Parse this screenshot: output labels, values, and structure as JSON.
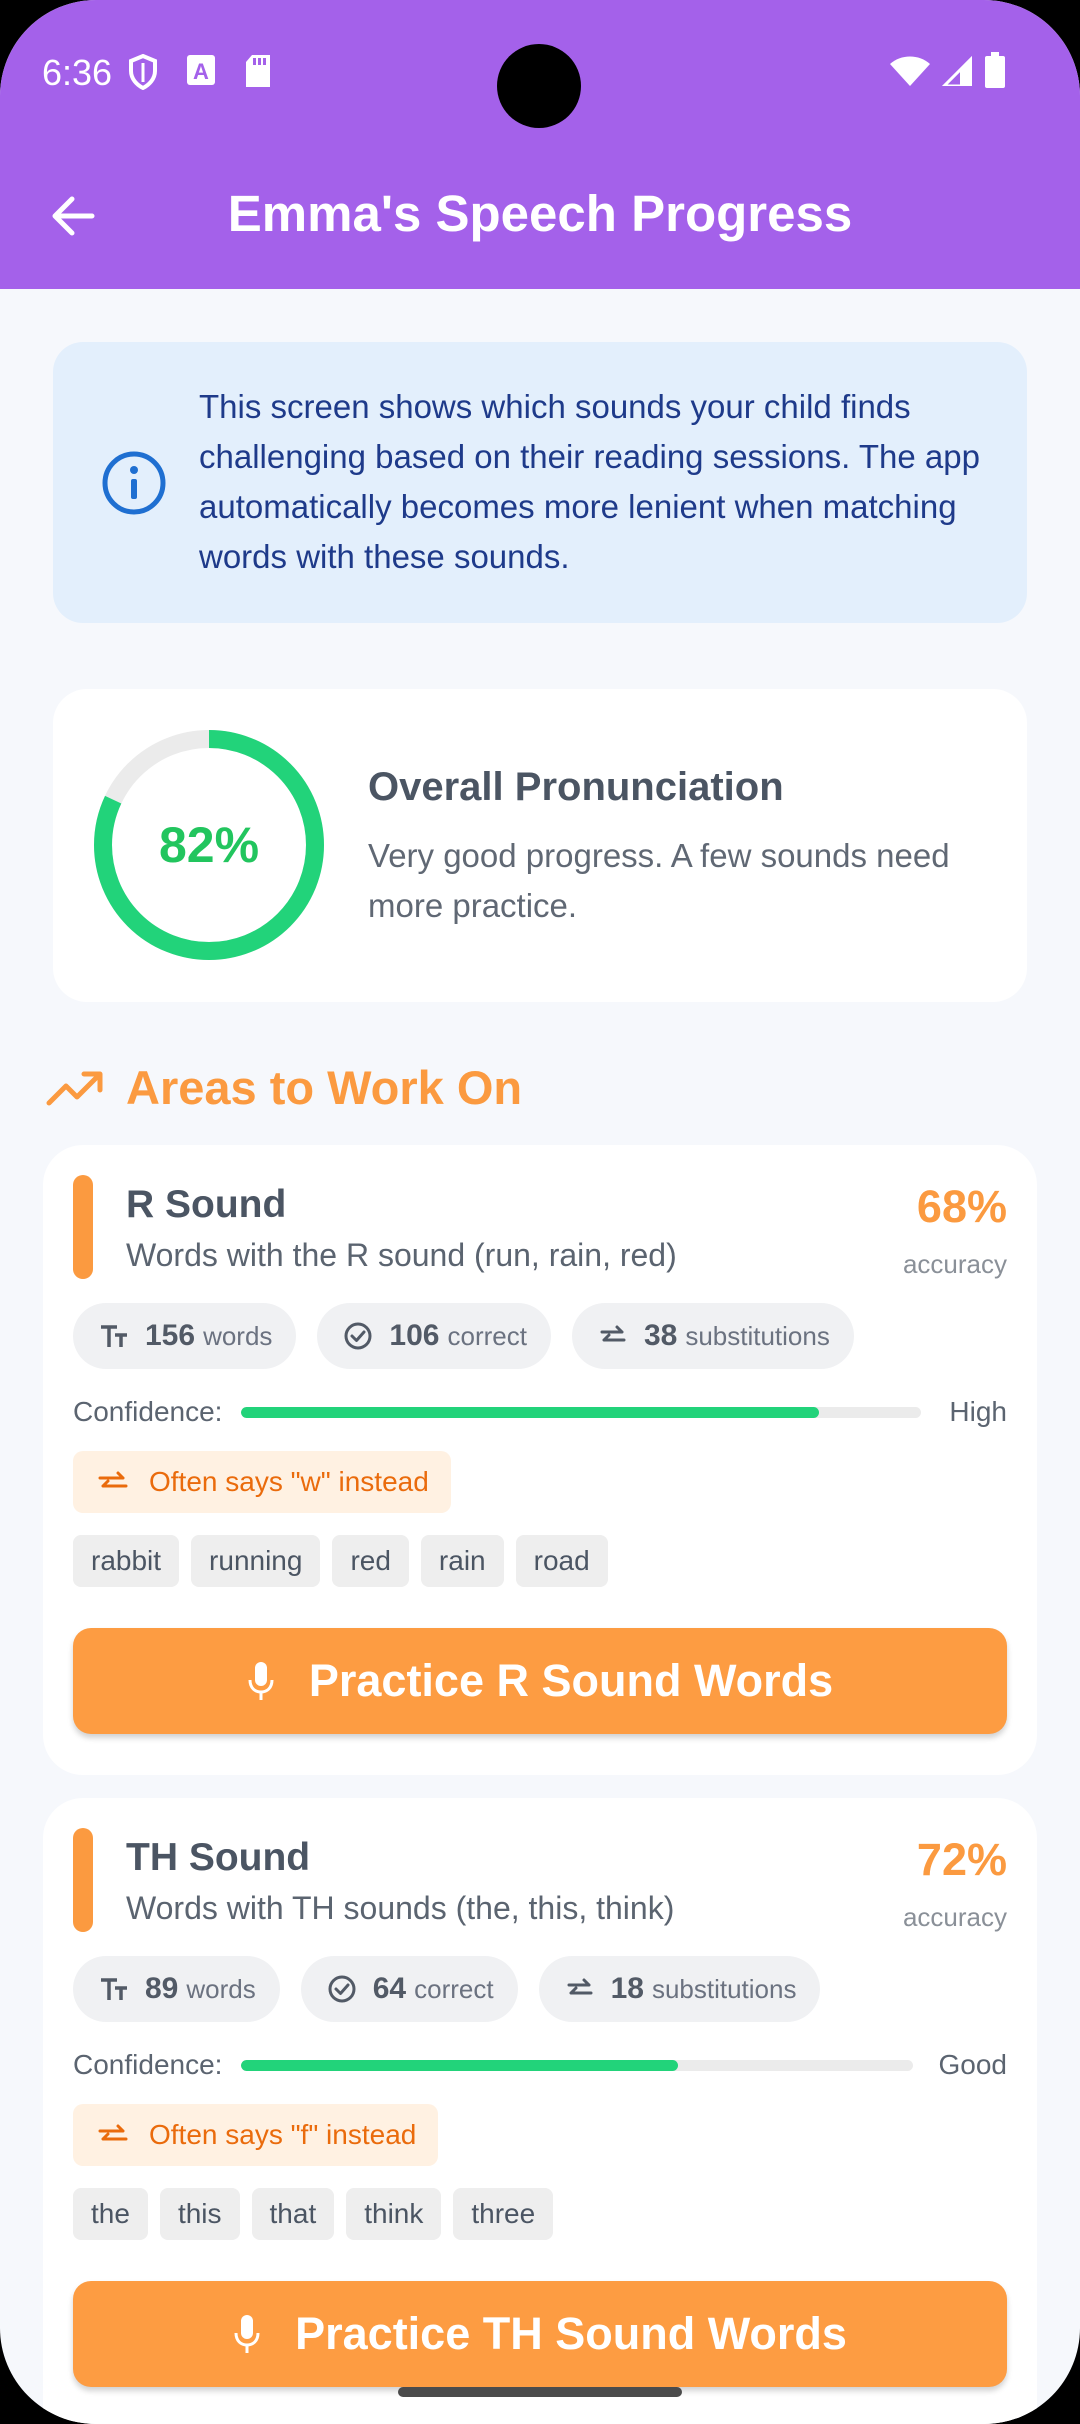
{
  "status_bar": {
    "time": "6:36"
  },
  "app_bar": {
    "title": "Emma's Speech Progress"
  },
  "info": {
    "text": "This screen shows which sounds your child finds challenging based on their reading sessions. The app automatically becomes more lenient when matching words with these sounds."
  },
  "overall": {
    "percent_label": "82%",
    "progress": 0.82,
    "title": "Overall Pronunciation",
    "subtitle": "Very good progress. A few sounds need more practice."
  },
  "section": {
    "title": "Areas to Work On"
  },
  "sounds": [
    {
      "title": "R Sound",
      "description": "Words with the R sound (run, rain, red)",
      "accuracy": "68%",
      "accuracy_label": "accuracy",
      "stats": [
        {
          "icon": "text-size-icon",
          "value": "156",
          "label": "words"
        },
        {
          "icon": "check-circle-icon",
          "value": "106",
          "label": "correct"
        },
        {
          "icon": "swap-arrows-icon",
          "value": "38",
          "label": "substitutions"
        }
      ],
      "confidence_label": "Confidence:",
      "confidence_level": "High",
      "confidence_value": 0.85,
      "tip": "Often says \"w\" instead",
      "words": [
        "rabbit",
        "running",
        "red",
        "rain",
        "road"
      ],
      "button": "Practice R Sound Words"
    },
    {
      "title": "TH Sound",
      "description": "Words with TH sounds (the, this, think)",
      "accuracy": "72%",
      "accuracy_label": "accuracy",
      "stats": [
        {
          "icon": "text-size-icon",
          "value": "89",
          "label": "words"
        },
        {
          "icon": "check-circle-icon",
          "value": "64",
          "label": "correct"
        },
        {
          "icon": "swap-arrows-icon",
          "value": "18",
          "label": "substitutions"
        }
      ],
      "confidence_label": "Confidence:",
      "confidence_level": "Good",
      "confidence_value": 0.65,
      "tip": "Often says \"f\" instead",
      "words": [
        "the",
        "this",
        "that",
        "think",
        "three"
      ],
      "button": "Practice TH Sound Words"
    }
  ],
  "colors": {
    "app_bar": "#a461ea",
    "accent_orange": "#fb9a40",
    "success_green": "#22c55e",
    "info_background": "#e3effc"
  }
}
